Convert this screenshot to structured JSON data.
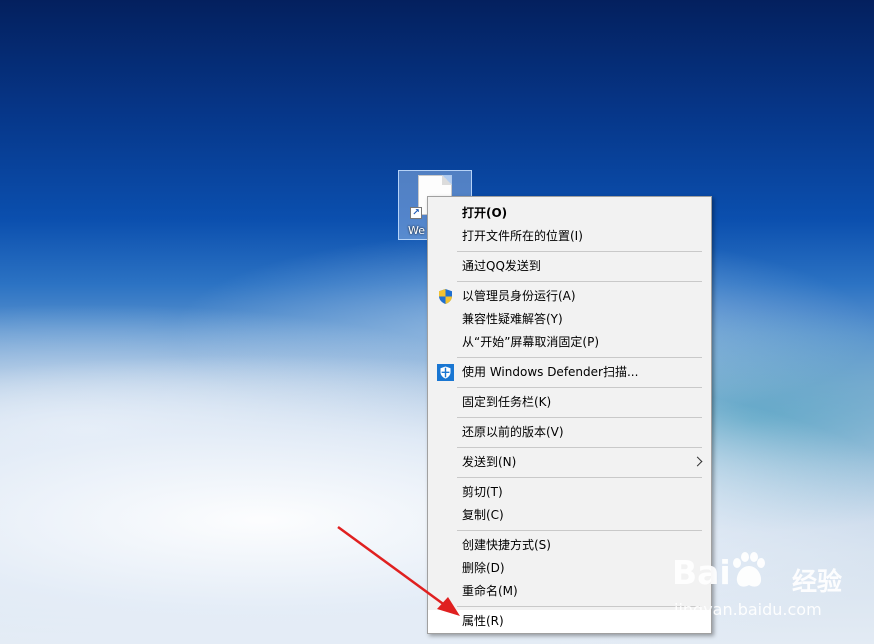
{
  "desktop": {
    "shortcut_label": "We"
  },
  "context_menu": {
    "items": [
      {
        "label": "打开(O)"
      },
      {
        "label": "打开文件所在的位置(I)"
      },
      {
        "label": "通过QQ发送到"
      },
      {
        "label": "以管理员身份运行(A)",
        "icon": "uac-shield-icon"
      },
      {
        "label": "兼容性疑难解答(Y)"
      },
      {
        "label": "从“开始”屏幕取消固定(P)"
      },
      {
        "label": "使用 Windows Defender扫描...",
        "icon": "windows-defender-icon"
      },
      {
        "label": "固定到任务栏(K)"
      },
      {
        "label": "还原以前的版本(V)"
      },
      {
        "label": "发送到(N)",
        "submenu": "chevron-right-icon"
      },
      {
        "label": "剪切(T)"
      },
      {
        "label": "复制(C)"
      },
      {
        "label": "创建快捷方式(S)"
      },
      {
        "label": "删除(D)"
      },
      {
        "label": "重命名(M)"
      },
      {
        "label": "属性(R)",
        "state": "highlighted"
      }
    ]
  },
  "annotation": {
    "arrow_color": "#e02020"
  },
  "watermark": {
    "brand_left": "Bai",
    "brand_right": "经验",
    "url": "jingyan.baidu.com"
  },
  "colors": {
    "menu_background": "#f2f2f2",
    "menu_border": "#a0a0a0",
    "highlight": "#ffffff",
    "shield_blue": "#1f6fd0",
    "shield_yellow": "#f2c230",
    "defender_blue": "#1976d2"
  }
}
